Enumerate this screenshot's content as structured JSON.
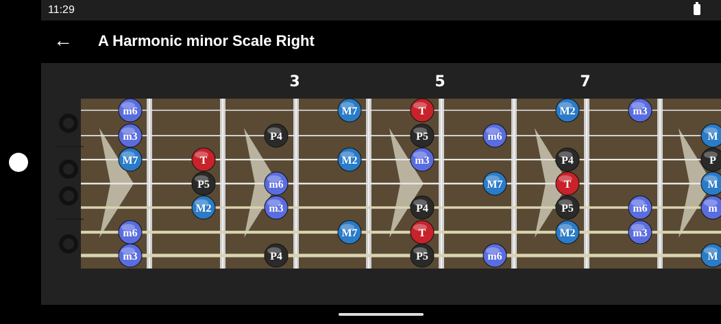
{
  "status_bar": {
    "time": "11:29",
    "battery_icon": "battery-full-icon"
  },
  "app_bar": {
    "back_icon": "arrow-back-icon",
    "title": "A Harmonic minor Scale Right"
  },
  "fretboard": {
    "fret_numbers": [
      "3",
      "5",
      "7"
    ],
    "colors": {
      "tonic": "#c8222a",
      "major": "#2a7bc8",
      "minor": "#5a6de0",
      "perfect": "#2a2a2a"
    },
    "notes": [
      {
        "s": 1,
        "f": 1,
        "l": "m6"
      },
      {
        "s": 1,
        "f": 4,
        "l": "M7"
      },
      {
        "s": 1,
        "f": 5,
        "l": "T"
      },
      {
        "s": 1,
        "f": 7,
        "l": "M2"
      },
      {
        "s": 1,
        "f": 8,
        "l": "m3"
      },
      {
        "s": 2,
        "f": 1,
        "l": "m3"
      },
      {
        "s": 2,
        "f": 3,
        "l": "P4"
      },
      {
        "s": 2,
        "f": 5,
        "l": "P5"
      },
      {
        "s": 2,
        "f": 6,
        "l": "m6"
      },
      {
        "s": 2,
        "f": 9,
        "l": "M"
      },
      {
        "s": 3,
        "f": 1,
        "l": "M7"
      },
      {
        "s": 3,
        "f": 2,
        "l": "T"
      },
      {
        "s": 3,
        "f": 4,
        "l": "M2"
      },
      {
        "s": 3,
        "f": 5,
        "l": "m3"
      },
      {
        "s": 3,
        "f": 7,
        "l": "P4"
      },
      {
        "s": 3,
        "f": 9,
        "l": "P"
      },
      {
        "s": 4,
        "f": 2,
        "l": "P5"
      },
      {
        "s": 4,
        "f": 3,
        "l": "m6"
      },
      {
        "s": 4,
        "f": 6,
        "l": "M7"
      },
      {
        "s": 4,
        "f": 7,
        "l": "T"
      },
      {
        "s": 4,
        "f": 9,
        "l": "M"
      },
      {
        "s": 5,
        "f": 2,
        "l": "M2"
      },
      {
        "s": 5,
        "f": 3,
        "l": "m3"
      },
      {
        "s": 5,
        "f": 5,
        "l": "P4"
      },
      {
        "s": 5,
        "f": 7,
        "l": "P5"
      },
      {
        "s": 5,
        "f": 8,
        "l": "m6"
      },
      {
        "s": 5,
        "f": 9,
        "l": "m"
      },
      {
        "s": 6,
        "f": 1,
        "l": "m6"
      },
      {
        "s": 6,
        "f": 4,
        "l": "M7"
      },
      {
        "s": 6,
        "f": 5,
        "l": "T"
      },
      {
        "s": 6,
        "f": 7,
        "l": "M2"
      },
      {
        "s": 6,
        "f": 8,
        "l": "m3"
      },
      {
        "s": 7,
        "f": 1,
        "l": "m3"
      },
      {
        "s": 7,
        "f": 3,
        "l": "P4"
      },
      {
        "s": 7,
        "f": 5,
        "l": "P5"
      },
      {
        "s": 7,
        "f": 6,
        "l": "m6"
      },
      {
        "s": 7,
        "f": 9,
        "l": "M"
      }
    ]
  }
}
